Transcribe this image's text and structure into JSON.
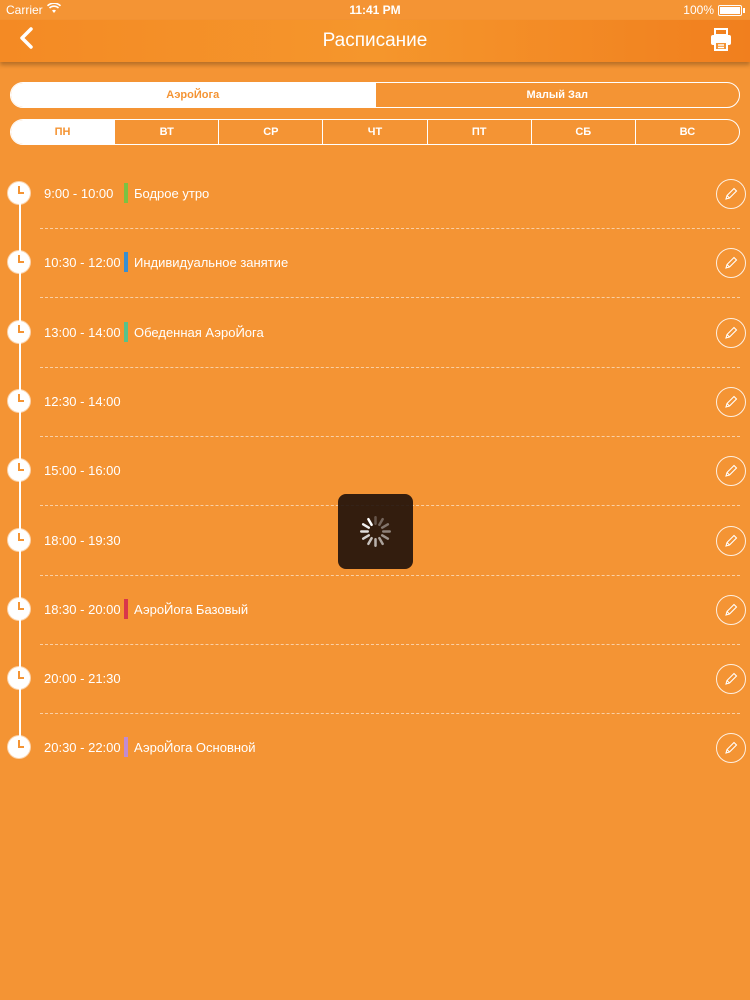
{
  "status_bar": {
    "carrier": "Carrier",
    "time": "11:41 PM",
    "battery": "100%"
  },
  "navbar": {
    "title": "Расписание"
  },
  "halls": [
    {
      "label": "АэроЙога",
      "active": true
    },
    {
      "label": "Малый Зал",
      "active": false
    }
  ],
  "days": [
    {
      "label": "ПН",
      "active": true
    },
    {
      "label": "ВТ",
      "active": false
    },
    {
      "label": "СР",
      "active": false
    },
    {
      "label": "ЧТ",
      "active": false
    },
    {
      "label": "ПТ",
      "active": false
    },
    {
      "label": "СБ",
      "active": false
    },
    {
      "label": "ВС",
      "active": false
    }
  ],
  "schedule": [
    {
      "time": "9:00 - 10:00",
      "name": "Бодрое утро",
      "color": "#7CC242"
    },
    {
      "time": "10:30 - 12:00",
      "name": "Индивидуальное занятие",
      "color": "#3A8FD0"
    },
    {
      "time": "13:00 - 14:00",
      "name": "Обеденная АэроЙога",
      "color": "#57C28A"
    },
    {
      "time": "12:30 - 14:00",
      "name": "",
      "color": ""
    },
    {
      "time": "15:00 - 16:00",
      "name": "",
      "color": ""
    },
    {
      "time": "18:00 - 19:30",
      "name": "",
      "color": ""
    },
    {
      "time": "18:30 - 20:00",
      "name": "АэроЙога Базовый",
      "color": "#D9364A"
    },
    {
      "time": "20:00 - 21:30",
      "name": "",
      "color": ""
    },
    {
      "time": "20:30 - 22:00",
      "name": "АэроЙога Основной",
      "color": "#C28BD0"
    }
  ]
}
